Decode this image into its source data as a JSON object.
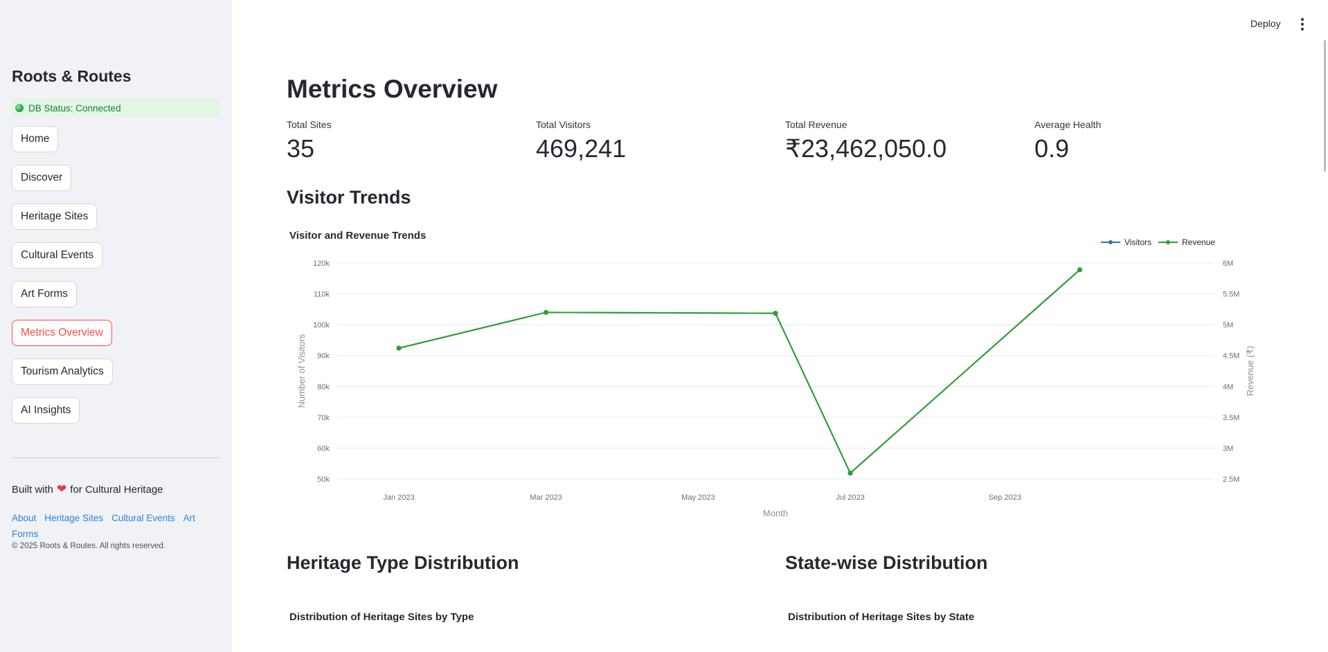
{
  "sidebar": {
    "brand": "Roots & Routes",
    "db_status": "DB Status: Connected",
    "nav": [
      {
        "label": "Home"
      },
      {
        "label": "Discover"
      },
      {
        "label": "Heritage Sites"
      },
      {
        "label": "Cultural Events"
      },
      {
        "label": "Art Forms"
      },
      {
        "label": "Metrics Overview",
        "active": true
      },
      {
        "label": "Tourism Analytics"
      },
      {
        "label": "AI Insights"
      }
    ],
    "built_prefix": "Built with",
    "built_suffix": "for Cultural Heritage",
    "footer_links": [
      "About",
      "Heritage Sites",
      "Cultural Events",
      "Art Forms"
    ],
    "copyright": "© 2025 Roots & Routes. All rights reserved."
  },
  "toolbar": {
    "deploy_label": "Deploy",
    "menu_icon": "kebab-menu-icon"
  },
  "main": {
    "title": "Metrics Overview",
    "metrics": [
      {
        "label": "Total Sites",
        "value": "35"
      },
      {
        "label": "Total Visitors",
        "value": "469,241"
      },
      {
        "label": "Total Revenue",
        "value": "₹23,462,050.0"
      },
      {
        "label": "Average Health",
        "value": "0.9"
      }
    ],
    "visitor_section_title": "Visitor Trends",
    "heritage_section_title": "Heritage Type Distribution",
    "heritage_chart_title": "Distribution of Heritage Sites by Type",
    "state_section_title": "State-wise Distribution",
    "state_chart_title": "Distribution of Heritage Sites by State"
  },
  "colors": {
    "accent": "#ff4b4b",
    "visitors": "#1f77b4",
    "revenue": "#2ca02c",
    "link": "#2b84d8"
  },
  "chart_data": {
    "type": "line",
    "title": "Visitor and Revenue Trends",
    "xlabel": "Month",
    "ylabel": "Number of Visitors",
    "y2label": "Revenue (₹)",
    "x_ticks": [
      "Jan 2023",
      "Mar 2023",
      "May 2023",
      "Jul 2023",
      "Sep 2023"
    ],
    "y_ticks": [
      "50k",
      "60k",
      "70k",
      "80k",
      "90k",
      "100k",
      "110k",
      "120k"
    ],
    "y2_ticks": [
      "2.5M",
      "3M",
      "3.5M",
      "4M",
      "4.5M",
      "5M",
      "5.5M",
      "6M"
    ],
    "ylim": [
      50000,
      120000
    ],
    "y2lim": [
      2500000,
      6000000
    ],
    "x_range": [
      "2022-12-07",
      "2023-11-24"
    ],
    "legend_position": "top-right",
    "grid": true,
    "series": [
      {
        "name": "Visitors",
        "axis": "left",
        "x": [
          "2023-01-01",
          "2023-03-01",
          "2023-06-01",
          "2023-07-01",
          "2023-10-01"
        ],
        "y": [
          92400,
          104000,
          103700,
          51900,
          117800
        ]
      },
      {
        "name": "Revenue",
        "axis": "right",
        "x": [
          "2023-01-01",
          "2023-03-01",
          "2023-06-01",
          "2023-07-01",
          "2023-10-01"
        ],
        "y": [
          4620000,
          5200000,
          5185000,
          2595000,
          5890000
        ]
      }
    ]
  }
}
